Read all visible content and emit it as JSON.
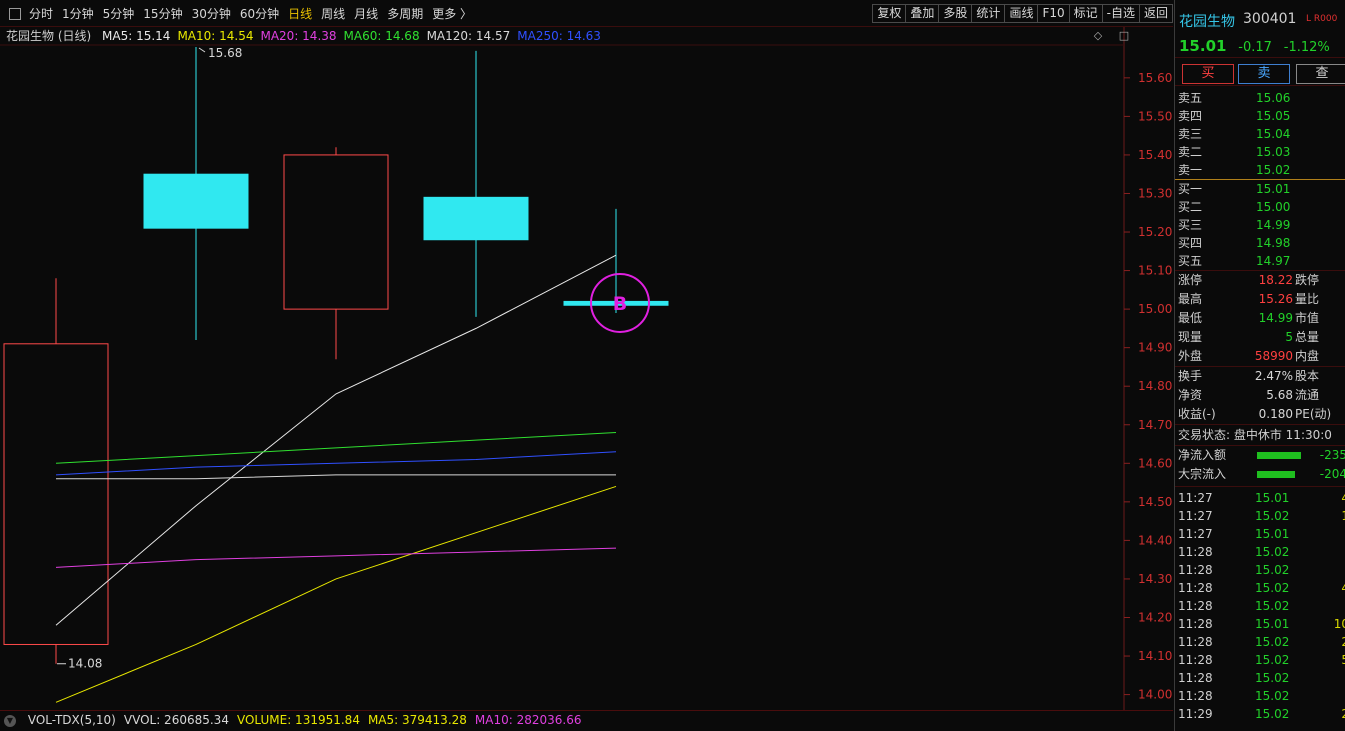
{
  "toolbar": {
    "periods": [
      "分时",
      "1分钟",
      "5分钟",
      "15分钟",
      "30分钟",
      "60分钟",
      "日线",
      "周线",
      "月线",
      "多周期",
      "更多 〉"
    ],
    "active_period": "日线",
    "tools": [
      "复权",
      "叠加",
      "多股",
      "统计",
      "画线",
      "F10",
      "标记",
      "-自选",
      "返回"
    ]
  },
  "legend": {
    "title": "花园生物 (日线)",
    "items": [
      {
        "label": "MA5: 15.14",
        "color": "#e8e8e8"
      },
      {
        "label": "MA10: 14.54",
        "color": "#e8e800"
      },
      {
        "label": "MA20: 14.38",
        "color": "#e040e0"
      },
      {
        "label": "MA60: 14.68",
        "color": "#30e030"
      },
      {
        "label": "MA120: 14.57",
        "color": "#d8d8d8"
      },
      {
        "label": "MA250: 14.63",
        "color": "#3050ff"
      }
    ],
    "btn_diamond": "◇",
    "btn_box": "□"
  },
  "chart_data": {
    "type": "candlestick",
    "y_ticks": [
      15.6,
      15.5,
      15.4,
      15.3,
      15.2,
      15.1,
      15.0,
      14.9,
      14.8,
      14.7,
      14.6,
      14.5,
      14.4,
      14.3,
      14.2,
      14.1,
      14.0
    ],
    "ylim": [
      13.96,
      15.68
    ],
    "candles": [
      {
        "open": 14.13,
        "high": 15.08,
        "low": 14.08,
        "close": 14.91,
        "up": true
      },
      {
        "open": 15.35,
        "high": 15.68,
        "low": 14.92,
        "close": 15.21,
        "up": false
      },
      {
        "open": 15.0,
        "high": 15.42,
        "low": 14.87,
        "close": 15.4,
        "up": true
      },
      {
        "open": 15.29,
        "high": 15.67,
        "low": 14.98,
        "close": 15.18,
        "up": false
      },
      {
        "open": 15.02,
        "high": 15.26,
        "low": 14.99,
        "close": 15.01,
        "up": false
      }
    ],
    "high_label": "15.68",
    "low_label": "14.08",
    "marker": "B",
    "ma_lines": [
      {
        "name": "MA5",
        "color": "#e8e8e8",
        "values": [
          14.18,
          14.49,
          14.78,
          14.95,
          15.14
        ]
      },
      {
        "name": "MA10",
        "color": "#e8e800",
        "values": [
          13.98,
          14.13,
          14.3,
          14.42,
          14.54
        ]
      },
      {
        "name": "MA20",
        "color": "#e040e0",
        "values": [
          14.33,
          14.35,
          14.36,
          14.37,
          14.38
        ]
      },
      {
        "name": "MA60",
        "color": "#30e030",
        "values": [
          14.6,
          14.62,
          14.64,
          14.66,
          14.68
        ]
      },
      {
        "name": "MA120",
        "color": "#d8d8d8",
        "values": [
          14.56,
          14.56,
          14.57,
          14.57,
          14.57
        ]
      },
      {
        "name": "MA250",
        "color": "#3050ff",
        "values": [
          14.57,
          14.59,
          14.6,
          14.61,
          14.63
        ]
      }
    ]
  },
  "volume": {
    "toggle": "▼",
    "items": [
      {
        "label": "VOL-TDX(5,10)",
        "color": "#d8d8d8"
      },
      {
        "label": "VVOL: 260685.34",
        "color": "#d8d8d8"
      },
      {
        "label": "VOLUME: 131951.84",
        "color": "#e8e800"
      },
      {
        "label": "MA5: 379413.28",
        "color": "#e8e800"
      },
      {
        "label": "MA10: 282036.66",
        "color": "#e040e0"
      }
    ]
  },
  "stock": {
    "name": "花园生物",
    "code": "300401",
    "tag": "L R000",
    "price": "15.01",
    "change": "-0.17",
    "pct": "-1.12%"
  },
  "trade": {
    "buy": "买",
    "sell": "卖",
    "query": "查"
  },
  "asks": [
    {
      "label": "卖五",
      "price": "15.06",
      "vol": ""
    },
    {
      "label": "卖四",
      "price": "15.05",
      "vol": ""
    },
    {
      "label": "卖三",
      "price": "15.04",
      "vol": ""
    },
    {
      "label": "卖二",
      "price": "15.03",
      "vol": ""
    },
    {
      "label": "卖一",
      "price": "15.02",
      "vol": ""
    }
  ],
  "bids": [
    {
      "label": "买一",
      "price": "15.01",
      "vol": ""
    },
    {
      "label": "买二",
      "price": "15.00",
      "vol": ""
    },
    {
      "label": "买三",
      "price": "14.99",
      "vol": ""
    },
    {
      "label": "买四",
      "price": "14.98",
      "vol": ""
    },
    {
      "label": "买五",
      "price": "14.97",
      "vol": ""
    }
  ],
  "stats1": [
    {
      "k": "涨停",
      "v": "18.22",
      "vc": "red",
      "k2": "跌停"
    },
    {
      "k": "最高",
      "v": "15.26",
      "vc": "red",
      "k2": "量比"
    },
    {
      "k": "最低",
      "v": "14.99",
      "vc": "green",
      "k2": "市值"
    },
    {
      "k": "现量",
      "v": "5",
      "vc": "green",
      "k2": "总量"
    },
    {
      "k": "外盘",
      "v": "58990",
      "vc": "red",
      "k2": "内盘"
    }
  ],
  "stats2": [
    {
      "k": "换手",
      "v": "2.47%",
      "vc": "white",
      "k2": "股本"
    },
    {
      "k": "净资",
      "v": "5.68",
      "vc": "white",
      "k2": "流通"
    },
    {
      "k": "收益(-)",
      "v": "0.180",
      "vc": "white",
      "k2": "PE(动)"
    }
  ],
  "status": "交易状态: 盘中休市 11:30:0",
  "flows": [
    {
      "k": "净流入额",
      "v": "-235",
      "bar": 0.6
    },
    {
      "k": "大宗流入",
      "v": "-204",
      "bar": 0.52
    }
  ],
  "ticks": [
    {
      "t": "11:27",
      "p": "15.01",
      "q": "4"
    },
    {
      "t": "11:27",
      "p": "15.02",
      "q": "1"
    },
    {
      "t": "11:27",
      "p": "15.01",
      "q": ""
    },
    {
      "t": "11:28",
      "p": "15.02",
      "q": ""
    },
    {
      "t": "11:28",
      "p": "15.02",
      "q": ""
    },
    {
      "t": "11:28",
      "p": "15.02",
      "q": "4"
    },
    {
      "t": "11:28",
      "p": "15.02",
      "q": ""
    },
    {
      "t": "11:28",
      "p": "15.01",
      "q": "10"
    },
    {
      "t": "11:28",
      "p": "15.02",
      "q": "2"
    },
    {
      "t": "11:28",
      "p": "15.02",
      "q": "5"
    },
    {
      "t": "11:28",
      "p": "15.02",
      "q": ""
    },
    {
      "t": "11:28",
      "p": "15.02",
      "q": ""
    },
    {
      "t": "11:29",
      "p": "15.02",
      "q": "2"
    }
  ]
}
